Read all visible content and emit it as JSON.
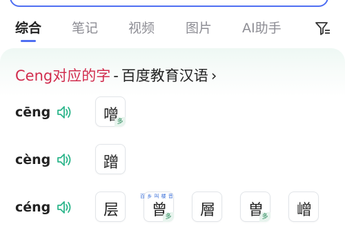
{
  "tabs": [
    {
      "label": "综合",
      "active": true
    },
    {
      "label": "笔记",
      "active": false
    },
    {
      "label": "视频",
      "active": false
    },
    {
      "label": "图片",
      "active": false
    },
    {
      "label": "AI助手",
      "active": false
    }
  ],
  "filter_icon": "filter-icon",
  "card": {
    "title_highlight": "Ceng对应的字",
    "title_separator": "-",
    "title_source": "百度教育汉语",
    "title_chevron": "›",
    "rows": [
      {
        "pinyin": "cēng",
        "chars": [
          {
            "char": "噌",
            "multi": true
          }
        ]
      },
      {
        "pinyin": "cèng",
        "chars": [
          {
            "char": "蹭",
            "multi": false
          }
        ]
      },
      {
        "pinyin": "céng",
        "chars": [
          {
            "char": "层",
            "multi": false
          },
          {
            "char": "曾",
            "multi": true
          },
          {
            "char": "層",
            "multi": false
          },
          {
            "char": "曽",
            "multi": true
          },
          {
            "char": "嶒",
            "multi": false
          }
        ]
      }
    ],
    "multi_badge": "多",
    "watermark": "百 乡 叫 楼 音"
  },
  "colors": {
    "accent": "#4e6ef2",
    "title_highlight": "#d12c4d",
    "speaker": "#2bb58a",
    "badge": "#2a8a5a"
  }
}
